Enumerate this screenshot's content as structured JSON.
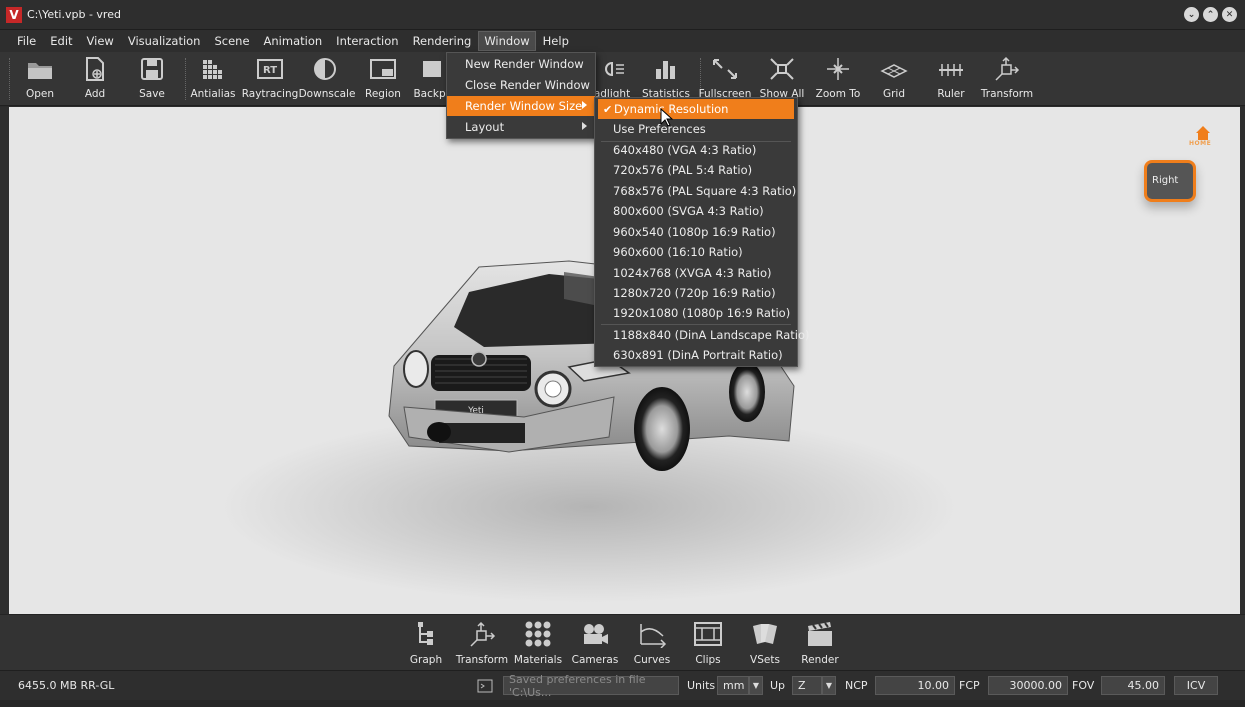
{
  "window": {
    "title": "C:\\Yeti.vpb - vred",
    "logo": "V"
  },
  "menubar": [
    "File",
    "Edit",
    "View",
    "Visualization",
    "Scene",
    "Animation",
    "Interaction",
    "Rendering",
    "Window",
    "Help"
  ],
  "toolbar": {
    "items": [
      {
        "label": "Open",
        "icon": "folder-icon"
      },
      {
        "label": "Add",
        "icon": "add-file-icon"
      },
      {
        "label": "Save",
        "icon": "floppy-icon"
      },
      {
        "label": "Antialias",
        "icon": "antialias-icon"
      },
      {
        "label": "Raytracing",
        "icon": "raytracing-icon"
      },
      {
        "label": "Downscale",
        "icon": "downscale-icon"
      },
      {
        "label": "Region",
        "icon": "region-icon"
      },
      {
        "label": "Backpl",
        "icon": "backplate-icon"
      },
      {
        "label": "adlight",
        "icon": "headlight-icon"
      },
      {
        "label": "Statistics",
        "icon": "statistics-icon"
      },
      {
        "label": "Fullscreen",
        "icon": "fullscreen-icon"
      },
      {
        "label": "Show All",
        "icon": "show-all-icon"
      },
      {
        "label": "Zoom To",
        "icon": "zoom-to-icon"
      },
      {
        "label": "Grid",
        "icon": "grid-icon"
      },
      {
        "label": "Ruler",
        "icon": "ruler-icon"
      },
      {
        "label": "Transform",
        "icon": "transform-icon"
      }
    ]
  },
  "window_menu": {
    "items": [
      "New Render Window",
      "Close Render Window",
      "Render Window Size",
      "Layout"
    ],
    "highlighted": "Render Window Size"
  },
  "size_submenu": {
    "checked": "Dynamic Resolution",
    "items": [
      "Dynamic Resolution",
      "Use Preferences",
      "640x480 (VGA 4:3 Ratio)",
      "720x576 (PAL 5:4 Ratio)",
      "768x576 (PAL Square 4:3 Ratio)",
      "800x600 (SVGA 4:3 Ratio)",
      "960x540 (1080p 16:9 Ratio)",
      "960x600 (16:10 Ratio)",
      "1024x768 (XVGA 4:3 Ratio)",
      "1280x720 (720p 16:9 Ratio)",
      "1920x1080 (1080p 16:9 Ratio)",
      "1188x840 (DinA Landscape Ratio)",
      "630x891 (DinA Portrait Ratio)"
    ]
  },
  "viewport": {
    "plate_text": "Yeti",
    "navcube_label": "Right",
    "home_label": "HOME"
  },
  "dock": {
    "items": [
      {
        "label": "Graph",
        "icon": "graph-icon"
      },
      {
        "label": "Transform",
        "icon": "transform-icon"
      },
      {
        "label": "Materials",
        "icon": "materials-icon"
      },
      {
        "label": "Cameras",
        "icon": "camera-icon"
      },
      {
        "label": "Curves",
        "icon": "curves-icon"
      },
      {
        "label": "Clips",
        "icon": "clips-icon"
      },
      {
        "label": "VSets",
        "icon": "vsets-icon"
      },
      {
        "label": "Render",
        "icon": "clapperboard-icon"
      }
    ]
  },
  "status": {
    "memory": "6455.0 MB  RR-GL",
    "message": "Saved preferences in file 'C:\\Us...",
    "units_label": "Units",
    "units_value": "mm",
    "up_label": "Up",
    "up_value": "Z",
    "ncp_label": "NCP",
    "ncp_value": "10.00",
    "fcp_label": "FCP",
    "fcp_value": "30000.00",
    "fov_label": "FOV",
    "fov_value": "45.00",
    "icv_label": "ICV"
  },
  "colors": {
    "accent": "#f07e1b",
    "background": "#2e2e2e",
    "viewport": "#e4e4e4"
  }
}
